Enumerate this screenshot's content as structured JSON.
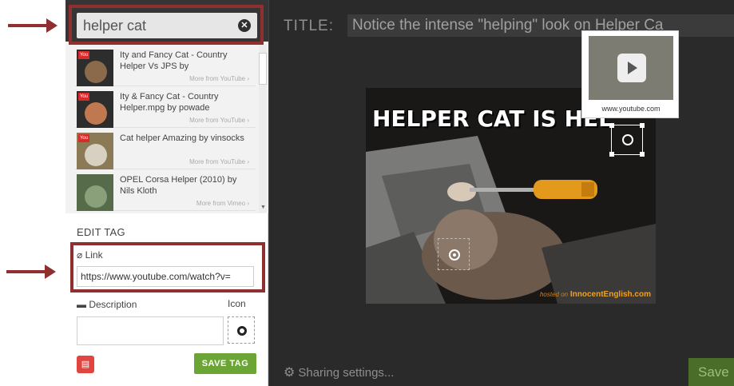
{
  "search": {
    "query": "helper cat"
  },
  "results": [
    {
      "title": "Ity and Fancy Cat - Country Helper Vs JPS by",
      "source": "More from YouTube ›"
    },
    {
      "title": "Ity & Fancy Cat - Country Helper.mpg by powade",
      "source": "More from YouTube ›"
    },
    {
      "title": "Cat helper Amazing by vinsocks",
      "source": "More from YouTube ›"
    },
    {
      "title": "OPEL Corsa Helper (2010) by Nils Kloth",
      "source": "More from Vimeo ›"
    }
  ],
  "edit_tag": {
    "heading": "EDIT TAG",
    "link_label": "Link",
    "link_value": "https://www.youtube.com/watch?v=",
    "description_label": "Description",
    "icon_label": "Icon",
    "save_label": "SAVE TAG"
  },
  "editor": {
    "title_label": "TITLE:",
    "title_value": "Notice the intense \"helping\" look on Helper Ca",
    "meme_text": "HELPER CAT IS HEL",
    "credit_hosted": "hosted on",
    "credit_site": "InnocentEnglish.com",
    "popup_url": "www.youtube.com",
    "sharing_label": "Sharing settings...",
    "save_label": "Save"
  },
  "colors": {
    "accent_red": "#8f2f2f",
    "save_green": "#6aa535",
    "delete_red": "#e0463f"
  }
}
